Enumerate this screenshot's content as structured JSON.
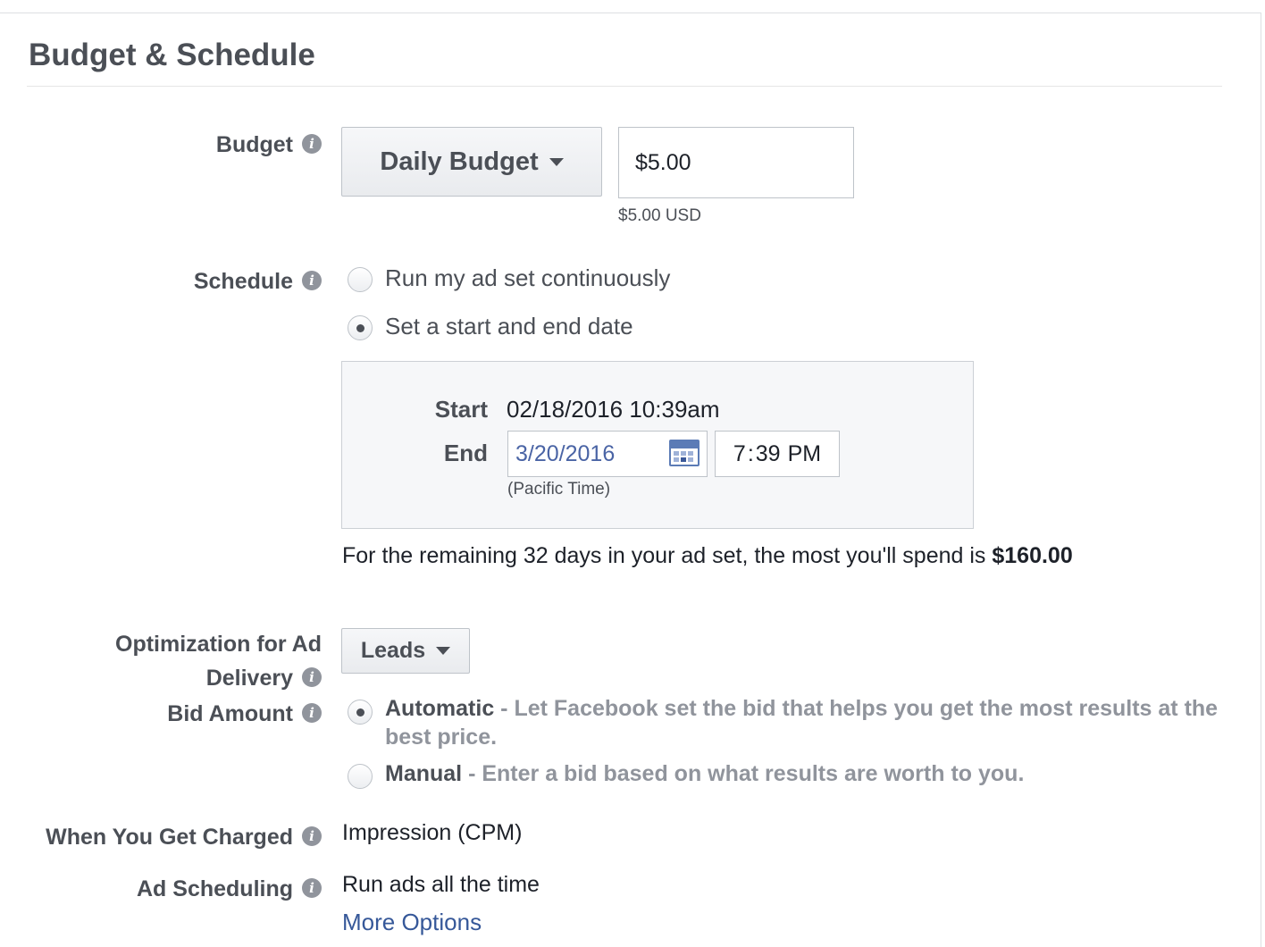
{
  "section": {
    "title": "Budget & Schedule"
  },
  "budget": {
    "label": "Budget",
    "type_label": "Daily Budget",
    "amount_value": "$5.00",
    "amount_hint": "$5.00 USD"
  },
  "schedule": {
    "label": "Schedule",
    "options": [
      {
        "label": "Run my ad set continuously",
        "selected": false
      },
      {
        "label": "Set a start and end date",
        "selected": true
      }
    ],
    "start_label": "Start",
    "start_value": "02/18/2016 10:39am",
    "end_label": "End",
    "end_date": "3/20/2016",
    "end_hour": "7",
    "end_sep": ":",
    "end_minute": "39",
    "end_ampm": "PM",
    "timezone": "(Pacific Time)",
    "summary_text": "For the remaining 32 days in your ad set, the most you'll spend is ",
    "summary_amount": "$160.00"
  },
  "optimization": {
    "label_line1": "Optimization for Ad",
    "label_line2": "Delivery",
    "value": "Leads"
  },
  "bid": {
    "label": "Bid Amount",
    "automatic_label": "Automatic",
    "automatic_desc": " - Let Facebook set the bid that helps you get the most results at the best price.",
    "manual_label": "Manual",
    "manual_desc": " - Enter a bid based on what results are worth to you."
  },
  "charged": {
    "label": "When You Get Charged",
    "value": "Impression (CPM)"
  },
  "ad_scheduling": {
    "label": "Ad Scheduling",
    "value": "Run ads all the time",
    "more_options": "More Options"
  },
  "icons": {
    "info": "info-icon",
    "calendar": "calendar-icon",
    "caret": "caret-down-icon"
  }
}
